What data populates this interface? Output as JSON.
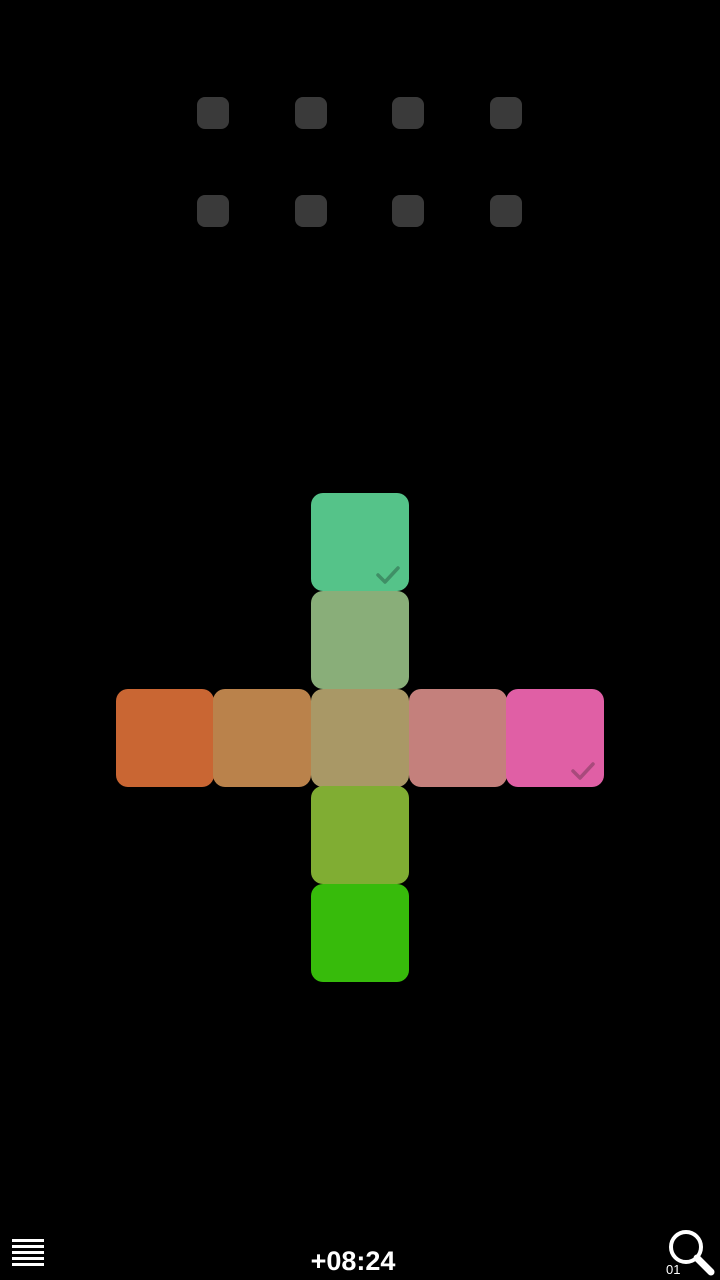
{
  "board": {
    "tiles": [
      {
        "id": "top",
        "color": "#55c389",
        "locked": true
      },
      {
        "id": "upper",
        "color": "#89ae79"
      },
      {
        "id": "far-left",
        "color": "#c96633"
      },
      {
        "id": "left",
        "color": "#ba824b"
      },
      {
        "id": "center",
        "color": "#a99866"
      },
      {
        "id": "right",
        "color": "#c4807c"
      },
      {
        "id": "far-right",
        "color": "#e05fa5",
        "locked": true
      },
      {
        "id": "lower",
        "color": "#80ad33"
      },
      {
        "id": "bottom",
        "color": "#37bb0b"
      }
    ],
    "check_color_top": "#3f8f66",
    "check_color_right": "#a84a7c",
    "empty_slot_color": "#3a3a3a"
  },
  "footer": {
    "menu_icon": "hamburger-menu-icon",
    "timer": "+08:24",
    "hint_icon": "magnifier-icon",
    "hint_count": "01"
  }
}
